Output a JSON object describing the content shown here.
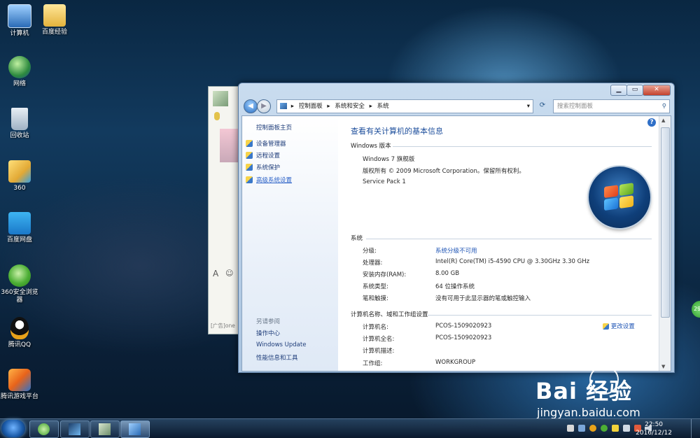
{
  "desktop": {
    "icons": [
      {
        "label": "计算机",
        "icon": "computer-icon"
      },
      {
        "label": "百度经验",
        "icon": "folder-icon"
      },
      {
        "label": "网络",
        "icon": "network-icon"
      },
      {
        "label": "回收站",
        "icon": "recycle-bin-icon"
      },
      {
        "label": "360",
        "icon": "folder-360-icon"
      },
      {
        "label": "百度网盘",
        "icon": "baidu-netdisk-icon"
      },
      {
        "label": "360安全浏览器",
        "icon": "360-browser-icon"
      },
      {
        "label": "腾讯QQ",
        "icon": "qq-icon"
      },
      {
        "label": "腾讯游戏平台",
        "icon": "tencent-games-icon"
      }
    ],
    "watermark": {
      "brand": "Bai  经验",
      "url": "jingyan.baidu.com"
    },
    "chat_window": {
      "ad_text": "[广告]one"
    },
    "side_badge": "29"
  },
  "window": {
    "breadcrumb": [
      "控制面板",
      "系统和安全",
      "系统"
    ],
    "search_placeholder": "搜索控制面板",
    "caption": {
      "minimize": "▁",
      "maximize": "▭",
      "close": "✕"
    },
    "left_pane": {
      "home": "控制面板主页",
      "links": [
        "设备管理器",
        "远程设置",
        "系统保护",
        "高级系统设置"
      ],
      "see_also_title": "另请参阅",
      "see_also": [
        "操作中心",
        "Windows Update",
        "性能信息和工具"
      ]
    },
    "main": {
      "title": "查看有关计算机的基本信息",
      "edition_section": "Windows 版本",
      "edition": "Windows 7 旗舰版",
      "copyright": "版权所有 © 2009 Microsoft Corporation。保留所有权利。",
      "service_pack": "Service Pack 1",
      "system_section": "系统",
      "system_rows": [
        {
          "label": "分级:",
          "value": "系统分级不可用",
          "link": true
        },
        {
          "label": "处理器:",
          "value": "Intel(R) Core(TM) i5-4590 CPU @ 3.30GHz   3.30 GHz",
          "link": false
        },
        {
          "label": "安装内存(RAM):",
          "value": "8.00 GB",
          "link": false
        },
        {
          "label": "系统类型:",
          "value": "64 位操作系统",
          "link": false
        },
        {
          "label": "笔和触摸:",
          "value": "没有可用于此显示器的笔或触控输入",
          "link": false
        }
      ],
      "computer_section": "计算机名称、域和工作组设置",
      "change_settings": "更改设置",
      "computer_rows": [
        {
          "label": "计算机名:",
          "value": "PCOS-1509020923"
        },
        {
          "label": "计算机全名:",
          "value": "PCOS-1509020923"
        },
        {
          "label": "计算机描述:",
          "value": ""
        },
        {
          "label": "工作组:",
          "value": "WORKGROUP"
        }
      ]
    }
  },
  "taskbar": {
    "time": "22:50",
    "date": "2016/12/12"
  }
}
